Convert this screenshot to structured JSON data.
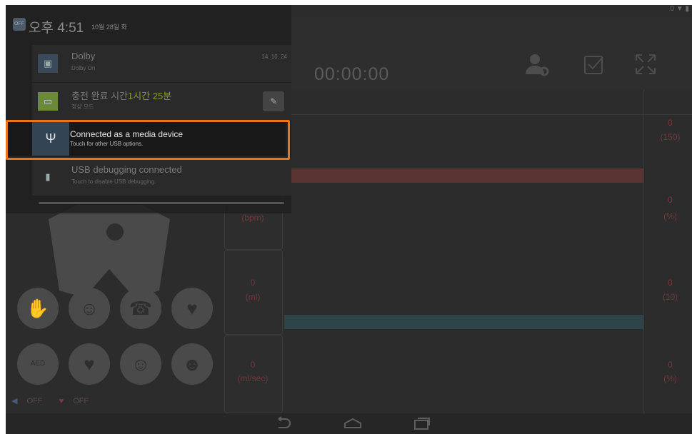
{
  "status_bar": {
    "right_icons": "0 ▼ ▮"
  },
  "header": {
    "timer": "00:00:00"
  },
  "measurements": {
    "left": [
      {
        "value": "",
        "unit": "(bpm)"
      },
      {
        "value": "0",
        "unit": "(ml)"
      },
      {
        "value": "0",
        "unit": "(ml/sec)"
      }
    ],
    "right": [
      {
        "value": "0",
        "unit": "(150)"
      },
      {
        "value": "0",
        "unit": "(%)"
      },
      {
        "value": "0",
        "unit": "(10)"
      },
      {
        "value": "0",
        "unit": "(%)"
      }
    ]
  },
  "bars": {
    "red": "#6a3c3a",
    "teal": "#2d4a4e"
  },
  "circle_buttons": [
    "AED"
  ],
  "toggles": {
    "voice": "OFF",
    "heart": "OFF"
  },
  "notification_shade": {
    "time": "오후 4:51",
    "date": "10월 28일 화",
    "items": [
      {
        "title": "Dolby",
        "subtitle": "Dolby On",
        "time": "14. 10. 24",
        "icon": "dolby-icon"
      },
      {
        "title": "충전 완료 시간",
        "highlight": "1시간 25분",
        "subtitle": "정상 모드",
        "icon": "battery-icon"
      },
      {
        "title": "Connected as a media device",
        "subtitle": "Touch for other USB options.",
        "icon": "usb-icon"
      },
      {
        "title": "USB debugging connected",
        "subtitle": "Touch to disable USB debugging.",
        "icon": "debug-icon"
      }
    ]
  },
  "colors": {
    "highlight_border": "#e8751a",
    "accent_green": "#9acd32"
  }
}
